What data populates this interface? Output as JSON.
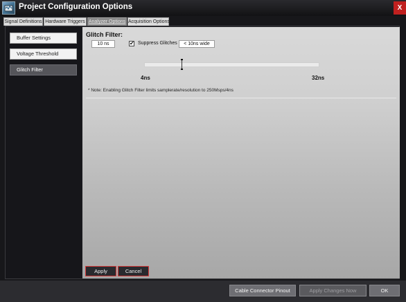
{
  "window": {
    "title": "Project Configuration Options",
    "close_label": "X"
  },
  "tabs": [
    {
      "label": "Signal Definitions",
      "active": false
    },
    {
      "label": "Hardware Triggers",
      "active": false
    },
    {
      "label": "Analyzer Options",
      "active": true
    },
    {
      "label": "Acquisition Options",
      "active": false
    }
  ],
  "sidebar": {
    "items": [
      {
        "label": "Buffer Settings",
        "active": false
      },
      {
        "label": "Voltage Threshold",
        "active": false
      },
      {
        "label": "Glitch Filter",
        "active": true
      }
    ]
  },
  "glitch_filter": {
    "title": "Glitch Filter:",
    "value": "10 ns",
    "suppress_label": "Suppress Glitches",
    "suppress_checked": true,
    "checkbox_mark": "✔",
    "width_value": "< 10ns wide",
    "slider_min_label": "4ns",
    "slider_max_label": "32ns",
    "note": "* Note: Enabling Glitch Filter limits samplerate/resolution to 250Msps/4ns",
    "apply_label": "Apply",
    "cancel_label": "Cancel"
  },
  "footer": {
    "cable_label": "Cable Connector Pinout",
    "apply_all_label": "Apply Changes Now",
    "ok_label": "OK"
  },
  "colors": {
    "close": "#c0201f",
    "active_item": "#55555a",
    "panel_button_border": "#d63a3a"
  }
}
